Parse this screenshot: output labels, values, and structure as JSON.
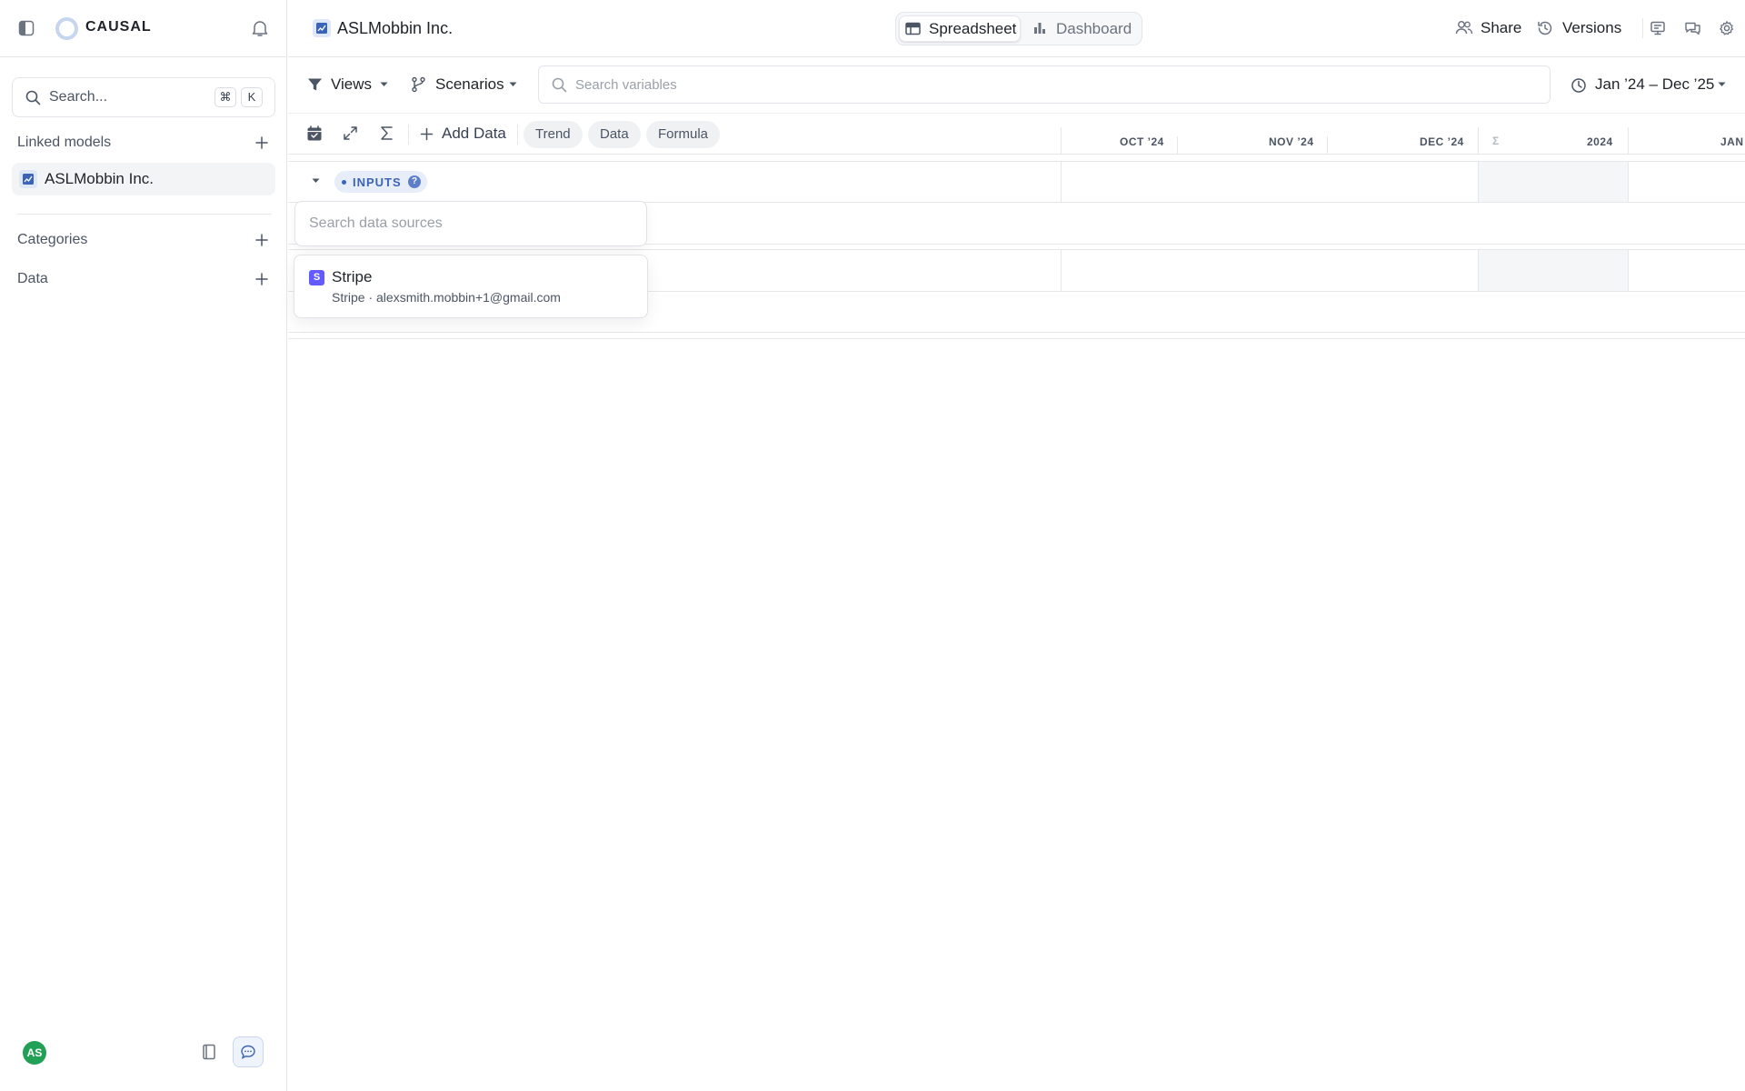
{
  "app": {
    "logo_text": "CAUSAL"
  },
  "sidebar": {
    "search_placeholder": "Search...",
    "shortcut_mod": "⌘",
    "shortcut_key": "K",
    "linked_models_label": "Linked models",
    "linked_models": [
      {
        "label": "ASLMobbin Inc."
      }
    ],
    "categories_label": "Categories",
    "data_label": "Data",
    "user_initials": "AS"
  },
  "topbar": {
    "model_title": "ASLMobbin Inc.",
    "view_tabs": [
      {
        "label": "Spreadsheet",
        "active": true
      },
      {
        "label": "Dashboard",
        "active": false
      }
    ],
    "share_label": "Share",
    "versions_label": "Versions"
  },
  "toolbar": {
    "views_label": "Views",
    "scenarios_label": "Scenarios",
    "search_placeholder": "Search variables",
    "date_range": "Jan ’24 – Dec ’25",
    "add_data_label": "Add Data",
    "chips": [
      "Trend",
      "Data",
      "Formula"
    ]
  },
  "columns": {
    "months": [
      "OCT ’24",
      "NOV ’24",
      "DEC ’24"
    ],
    "sum_symbol": "Σ",
    "year": "2024",
    "next": "JAN"
  },
  "group": {
    "label": "INPUTS",
    "help": "?"
  },
  "data_source_picker": {
    "search_placeholder": "Search data sources",
    "items": [
      {
        "name": "Stripe",
        "logo_letter": "S",
        "detail": "Stripe · alexsmith.mobbin+1@gmail.com"
      }
    ]
  },
  "colors": {
    "accent": "#3b63b8",
    "stripe": "#635bff",
    "avatar": "#22a055"
  }
}
